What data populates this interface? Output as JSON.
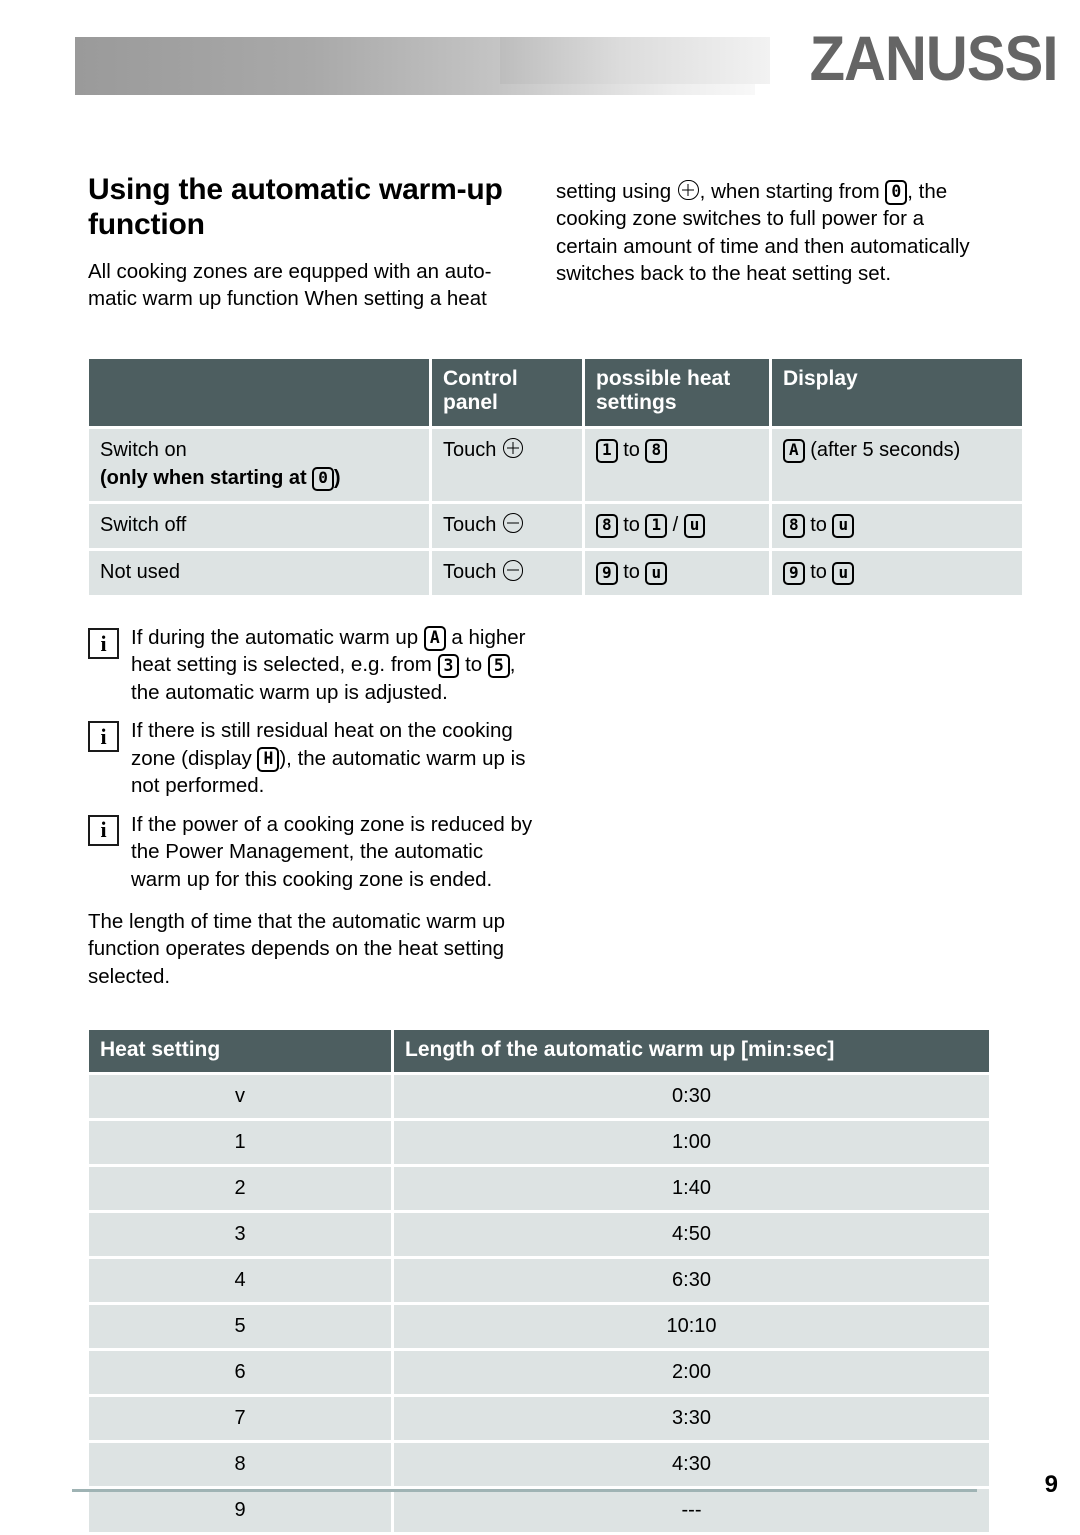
{
  "header": {
    "brand": "ZANUSSI"
  },
  "left_column": {
    "title": "Using the automatic warm-up function",
    "intro_paragraph": "All cooking zones are equpped with an auto-matic warm up function When setting a heat"
  },
  "right_column": {
    "paragraph_part1": "setting using ",
    "symbol_plus": "plus-icon",
    "paragraph_part2": ", when starting from ",
    "glyph_zero": "0",
    "paragraph_part3": ", the cooking zone switches to full power for a certain amount of time and then automatically switches back to the heat setting set."
  },
  "table_control": {
    "headers": [
      "",
      "Control panel",
      "possible heat settings",
      "Display"
    ],
    "header_control_panel": "Control panel",
    "header_possible_heat": "possible heat settings",
    "header_display": "Display",
    "rows": [
      {
        "action": "Switch on",
        "action_bold": "(only when starting at",
        "action_bold_glyph": "0",
        "action_bold_close": ")",
        "touch_label": "Touch",
        "touch_symbol": "plus-icon",
        "heat_from": "1",
        "heat_joiner": "to",
        "heat_to": "8",
        "display_glyph": "A",
        "display_note": "(after 5 seconds)"
      },
      {
        "action": "Switch off",
        "touch_label": "Touch",
        "touch_symbol": "minus-icon",
        "heat_from": "8",
        "heat_joiner": "to",
        "heat_to": "1",
        "heat_alt_sep": "/",
        "heat_alt": "u",
        "display_from": "8",
        "display_joiner": "to",
        "display_to": "u"
      },
      {
        "action": "Not used",
        "touch_label": "Touch",
        "touch_symbol": "minus-icon",
        "heat_from": "9",
        "heat_joiner": "to",
        "heat_to": "u",
        "display_from": "9",
        "display_joiner": "to",
        "display_to": "u"
      }
    ]
  },
  "notes": [
    {
      "icon": "info-icon",
      "part1": "If during the automatic warm up ",
      "glyph1": "A",
      "part2": " a higher heat setting is selected, e.g. from ",
      "glyph2": "3",
      "part3": " to ",
      "glyph3": "5",
      "part4": ", the automatic warm up is adjusted."
    },
    {
      "icon": "info-icon",
      "part1": "If there is still residual heat on the cooking zone (display ",
      "glyph1": "H",
      "part2": "), the automatic warm up is not performed."
    },
    {
      "icon": "info-icon",
      "part1": "If the power of a cooking zone is reduced by the Power Management, the automatic warm up for this cooking zone is ended."
    }
  ],
  "after_notes_paragraph": "The length of time that the automatic warm up function operates depends on the heat setting selected.",
  "table_length": {
    "headers": [
      "Heat setting",
      "Length of the  automatic warm up [min:sec]"
    ],
    "header_heat_setting": "Heat setting",
    "header_length": "Length of the  automatic warm up [min:sec]",
    "rows": [
      {
        "setting": "v",
        "length": "0:30"
      },
      {
        "setting": "1",
        "length": "1:00"
      },
      {
        "setting": "2",
        "length": "1:40"
      },
      {
        "setting": "3",
        "length": "4:50"
      },
      {
        "setting": "4",
        "length": "6:30"
      },
      {
        "setting": "5",
        "length": "10:10"
      },
      {
        "setting": "6",
        "length": "2:00"
      },
      {
        "setting": "7",
        "length": "3:30"
      },
      {
        "setting": "8",
        "length": "4:30"
      },
      {
        "setting": "9",
        "length": "---"
      }
    ]
  },
  "footer": {
    "page_number": "9"
  },
  "colors": {
    "table_header_bg": "#4d5e60",
    "table_cell_bg": "#dde3e3",
    "logo_gray": "#656565",
    "footer_rule": "#9fb3b4"
  }
}
